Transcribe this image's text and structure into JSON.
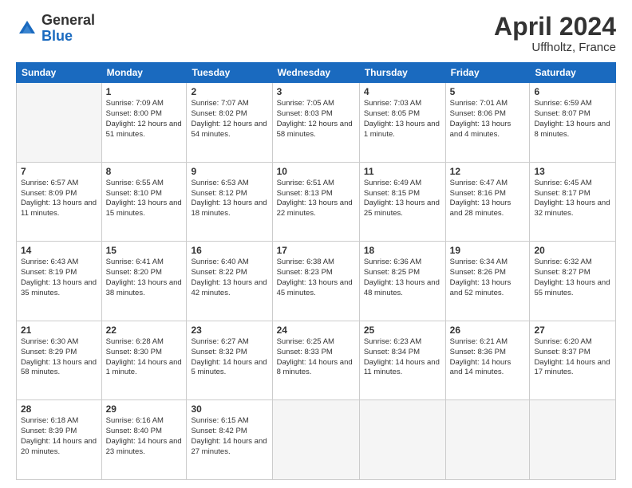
{
  "header": {
    "logo_general": "General",
    "logo_blue": "Blue",
    "month_title": "April 2024",
    "location": "Uffholtz, France"
  },
  "days_of_week": [
    "Sunday",
    "Monday",
    "Tuesday",
    "Wednesday",
    "Thursday",
    "Friday",
    "Saturday"
  ],
  "weeks": [
    [
      {
        "day": "",
        "info": ""
      },
      {
        "day": "1",
        "info": "Sunrise: 7:09 AM\nSunset: 8:00 PM\nDaylight: 12 hours\nand 51 minutes."
      },
      {
        "day": "2",
        "info": "Sunrise: 7:07 AM\nSunset: 8:02 PM\nDaylight: 12 hours\nand 54 minutes."
      },
      {
        "day": "3",
        "info": "Sunrise: 7:05 AM\nSunset: 8:03 PM\nDaylight: 12 hours\nand 58 minutes."
      },
      {
        "day": "4",
        "info": "Sunrise: 7:03 AM\nSunset: 8:05 PM\nDaylight: 13 hours\nand 1 minute."
      },
      {
        "day": "5",
        "info": "Sunrise: 7:01 AM\nSunset: 8:06 PM\nDaylight: 13 hours\nand 4 minutes."
      },
      {
        "day": "6",
        "info": "Sunrise: 6:59 AM\nSunset: 8:07 PM\nDaylight: 13 hours\nand 8 minutes."
      }
    ],
    [
      {
        "day": "7",
        "info": "Sunrise: 6:57 AM\nSunset: 8:09 PM\nDaylight: 13 hours\nand 11 minutes."
      },
      {
        "day": "8",
        "info": "Sunrise: 6:55 AM\nSunset: 8:10 PM\nDaylight: 13 hours\nand 15 minutes."
      },
      {
        "day": "9",
        "info": "Sunrise: 6:53 AM\nSunset: 8:12 PM\nDaylight: 13 hours\nand 18 minutes."
      },
      {
        "day": "10",
        "info": "Sunrise: 6:51 AM\nSunset: 8:13 PM\nDaylight: 13 hours\nand 22 minutes."
      },
      {
        "day": "11",
        "info": "Sunrise: 6:49 AM\nSunset: 8:15 PM\nDaylight: 13 hours\nand 25 minutes."
      },
      {
        "day": "12",
        "info": "Sunrise: 6:47 AM\nSunset: 8:16 PM\nDaylight: 13 hours\nand 28 minutes."
      },
      {
        "day": "13",
        "info": "Sunrise: 6:45 AM\nSunset: 8:17 PM\nDaylight: 13 hours\nand 32 minutes."
      }
    ],
    [
      {
        "day": "14",
        "info": "Sunrise: 6:43 AM\nSunset: 8:19 PM\nDaylight: 13 hours\nand 35 minutes."
      },
      {
        "day": "15",
        "info": "Sunrise: 6:41 AM\nSunset: 8:20 PM\nDaylight: 13 hours\nand 38 minutes."
      },
      {
        "day": "16",
        "info": "Sunrise: 6:40 AM\nSunset: 8:22 PM\nDaylight: 13 hours\nand 42 minutes."
      },
      {
        "day": "17",
        "info": "Sunrise: 6:38 AM\nSunset: 8:23 PM\nDaylight: 13 hours\nand 45 minutes."
      },
      {
        "day": "18",
        "info": "Sunrise: 6:36 AM\nSunset: 8:25 PM\nDaylight: 13 hours\nand 48 minutes."
      },
      {
        "day": "19",
        "info": "Sunrise: 6:34 AM\nSunset: 8:26 PM\nDaylight: 13 hours\nand 52 minutes."
      },
      {
        "day": "20",
        "info": "Sunrise: 6:32 AM\nSunset: 8:27 PM\nDaylight: 13 hours\nand 55 minutes."
      }
    ],
    [
      {
        "day": "21",
        "info": "Sunrise: 6:30 AM\nSunset: 8:29 PM\nDaylight: 13 hours\nand 58 minutes."
      },
      {
        "day": "22",
        "info": "Sunrise: 6:28 AM\nSunset: 8:30 PM\nDaylight: 14 hours\nand 1 minute."
      },
      {
        "day": "23",
        "info": "Sunrise: 6:27 AM\nSunset: 8:32 PM\nDaylight: 14 hours\nand 5 minutes."
      },
      {
        "day": "24",
        "info": "Sunrise: 6:25 AM\nSunset: 8:33 PM\nDaylight: 14 hours\nand 8 minutes."
      },
      {
        "day": "25",
        "info": "Sunrise: 6:23 AM\nSunset: 8:34 PM\nDaylight: 14 hours\nand 11 minutes."
      },
      {
        "day": "26",
        "info": "Sunrise: 6:21 AM\nSunset: 8:36 PM\nDaylight: 14 hours\nand 14 minutes."
      },
      {
        "day": "27",
        "info": "Sunrise: 6:20 AM\nSunset: 8:37 PM\nDaylight: 14 hours\nand 17 minutes."
      }
    ],
    [
      {
        "day": "28",
        "info": "Sunrise: 6:18 AM\nSunset: 8:39 PM\nDaylight: 14 hours\nand 20 minutes."
      },
      {
        "day": "29",
        "info": "Sunrise: 6:16 AM\nSunset: 8:40 PM\nDaylight: 14 hours\nand 23 minutes."
      },
      {
        "day": "30",
        "info": "Sunrise: 6:15 AM\nSunset: 8:42 PM\nDaylight: 14 hours\nand 27 minutes."
      },
      {
        "day": "",
        "info": ""
      },
      {
        "day": "",
        "info": ""
      },
      {
        "day": "",
        "info": ""
      },
      {
        "day": "",
        "info": ""
      }
    ]
  ]
}
